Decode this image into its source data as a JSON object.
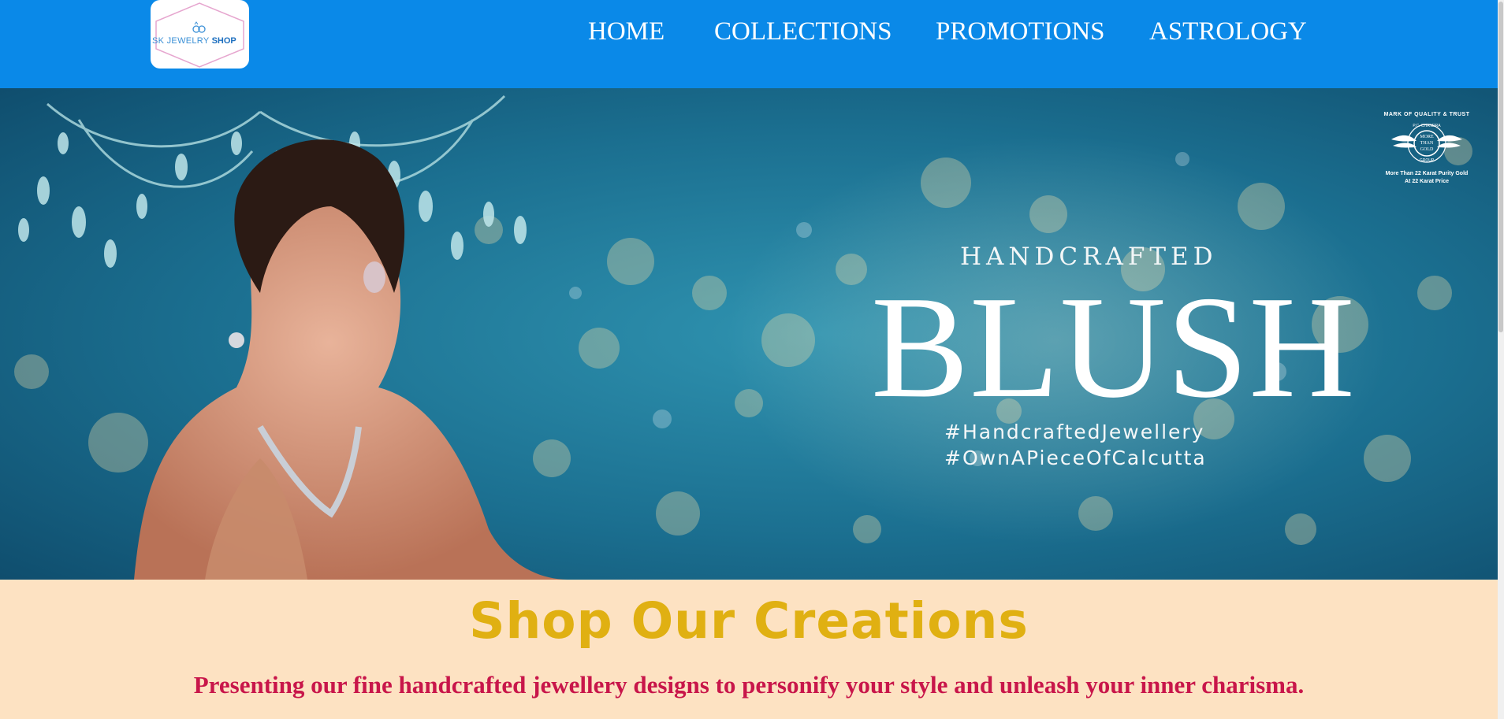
{
  "logo": {
    "text_part1": "SK JEWELRY",
    "text_part2": "SHOP"
  },
  "nav": {
    "items": [
      {
        "label": "HOME"
      },
      {
        "label": "COLLECTIONS"
      },
      {
        "label": "PROMOTIONS"
      },
      {
        "label": "ASTROLOGY"
      }
    ]
  },
  "banner": {
    "label": "HANDCRAFTED",
    "headline": "BLUSH",
    "hashtags": [
      "#HandcraftedJewellery",
      "#OwnAPieceOfCalcutta"
    ],
    "badge": {
      "top": "MARK OF QUALITY & TRUST",
      "emblem_lines": [
        "MORE",
        "THAN",
        "GOLD"
      ],
      "ring_top": "P.C. CHANDRA",
      "ring_bottom": "GROUP",
      "line1": "More Than 22 Karat Purity Gold",
      "line2": "At 22 Karat Price"
    }
  },
  "section": {
    "title": "Shop Our Creations",
    "subtitle": "Presenting our fine handcrafted jewellery designs to personify your style and unleash your inner charisma."
  },
  "colors": {
    "nav_bg": "#0a89e8",
    "page_bg": "#fde2c2",
    "title": "#e0b012",
    "subtitle": "#c8164a"
  }
}
